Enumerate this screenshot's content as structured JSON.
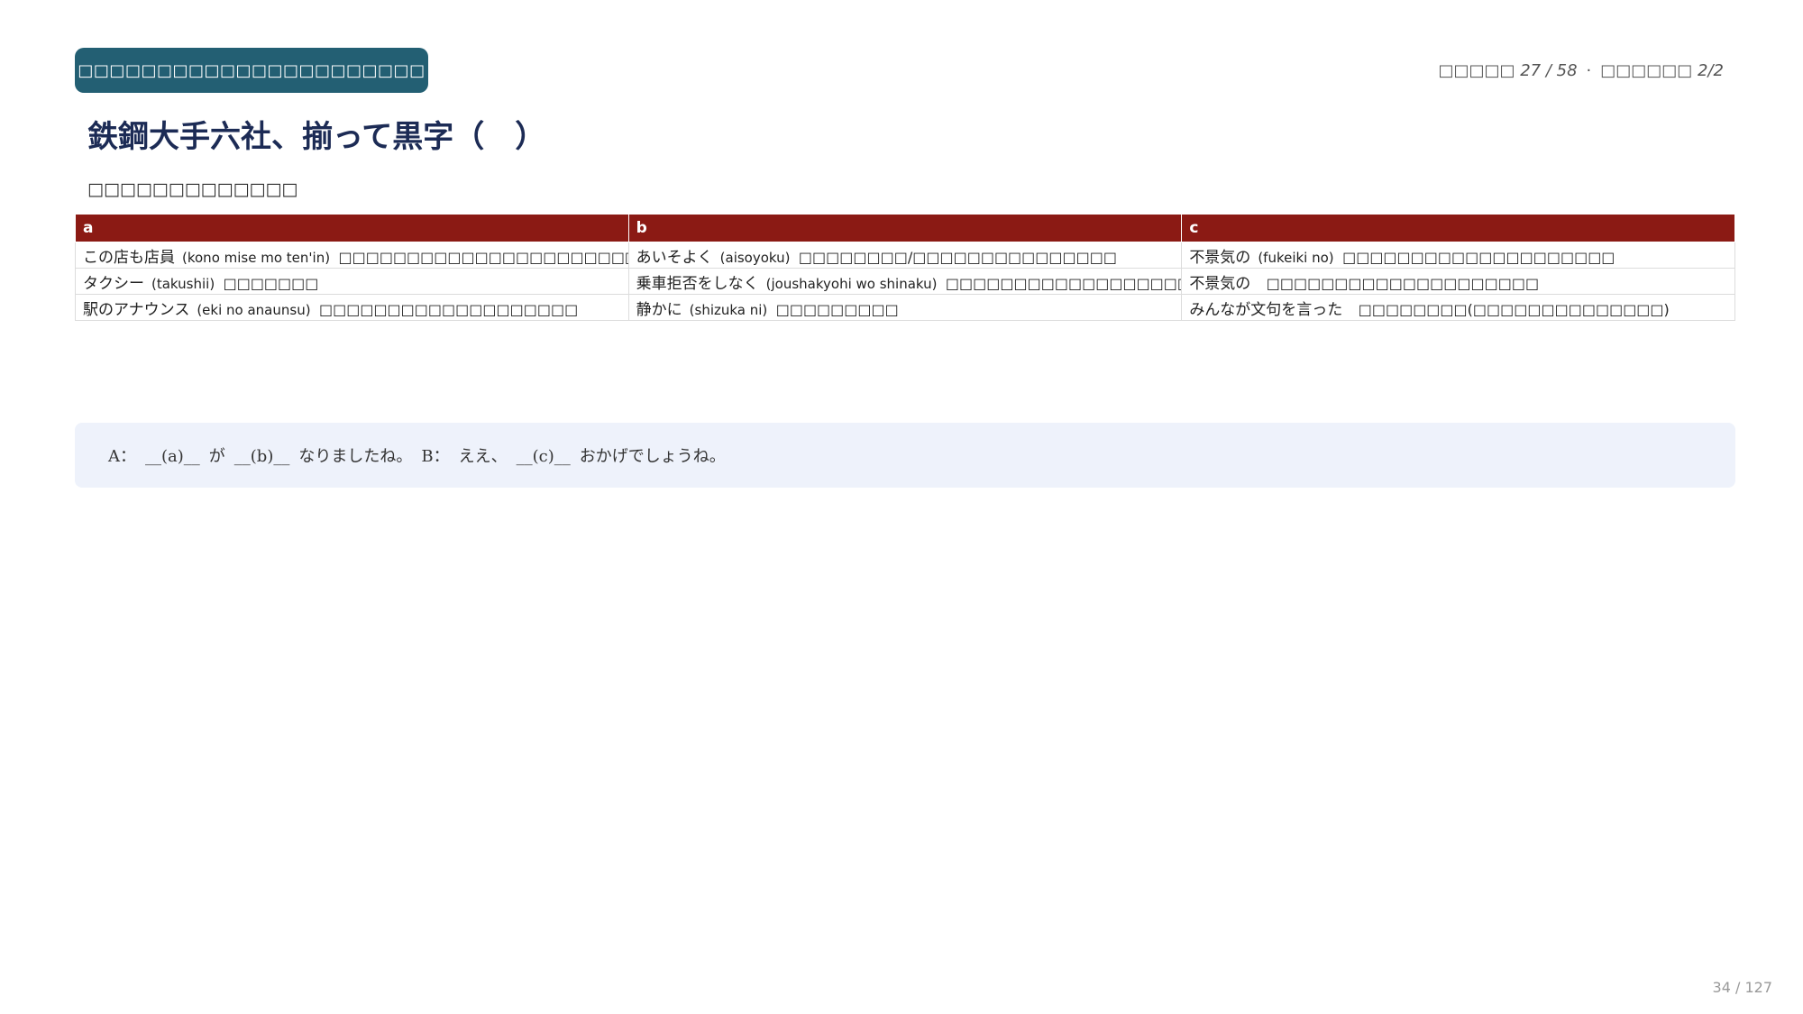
{
  "header": {
    "badge": "□□□□□□□□□□□□□□□□□□□□□□",
    "progress_left": "□□□□□ 27 / 58",
    "progress_sep": "·",
    "progress_right": "□□□□□□ 2/2"
  },
  "title": "鉄鋼大手六社、揃って黒字（　）",
  "subtitle": "□□□□□□□□□□□□□",
  "table": {
    "headers": [
      "a",
      "b",
      "c"
    ],
    "rows": [
      [
        {
          "jp": "この店も店員",
          "romaji": "(kono mise mo ten'in)",
          "meaning": "□□□□□□□□□□□□□□□□□□□□□□□□□□□□"
        },
        {
          "jp": "あいそよく",
          "romaji": "(aisoyoku)",
          "meaning": "□□□□□□□□/□□□□□□□□□□□□□□□"
        },
        {
          "jp": "不景気の",
          "romaji": "(fukeiki no)",
          "meaning": "□□□□□□□□□□□□□□□□□□□□"
        }
      ],
      [
        {
          "jp": "タクシー",
          "romaji": "(takushii)",
          "meaning": "□□□□□□□"
        },
        {
          "jp": "乗車拒否をしなく",
          "romaji": "(joushakyohi wo shinaku)",
          "meaning": "□□□□□□□□□□□□□□□□□□□□"
        },
        {
          "jp": "不景気の",
          "romaji": "",
          "meaning": "□□□□□□□□□□□□□□□□□□□□"
        }
      ],
      [
        {
          "jp": "駅のアナウンス",
          "romaji": "(eki no anaunsu)",
          "meaning": "□□□□□□□□□□□□□□□□□□□"
        },
        {
          "jp": "静かに",
          "romaji": "(shizuka ni)",
          "meaning": "□□□□□□□□□"
        },
        {
          "jp": "みんなが文句を言った",
          "romaji": "",
          "meaning": "□□□□□□□□(□□□□□□□□□□□□□□)"
        }
      ]
    ]
  },
  "dialogue": {
    "a_label": "A：",
    "blank_a": "__(a)__",
    "ga": "が",
    "blank_b": "__(b)__",
    "a_end": "なりましたね。",
    "b_label": "B：",
    "ee": "ええ、",
    "blank_c": "__(c)__",
    "b_end": "おかげでしょうね。"
  },
  "page": "34 / 127"
}
